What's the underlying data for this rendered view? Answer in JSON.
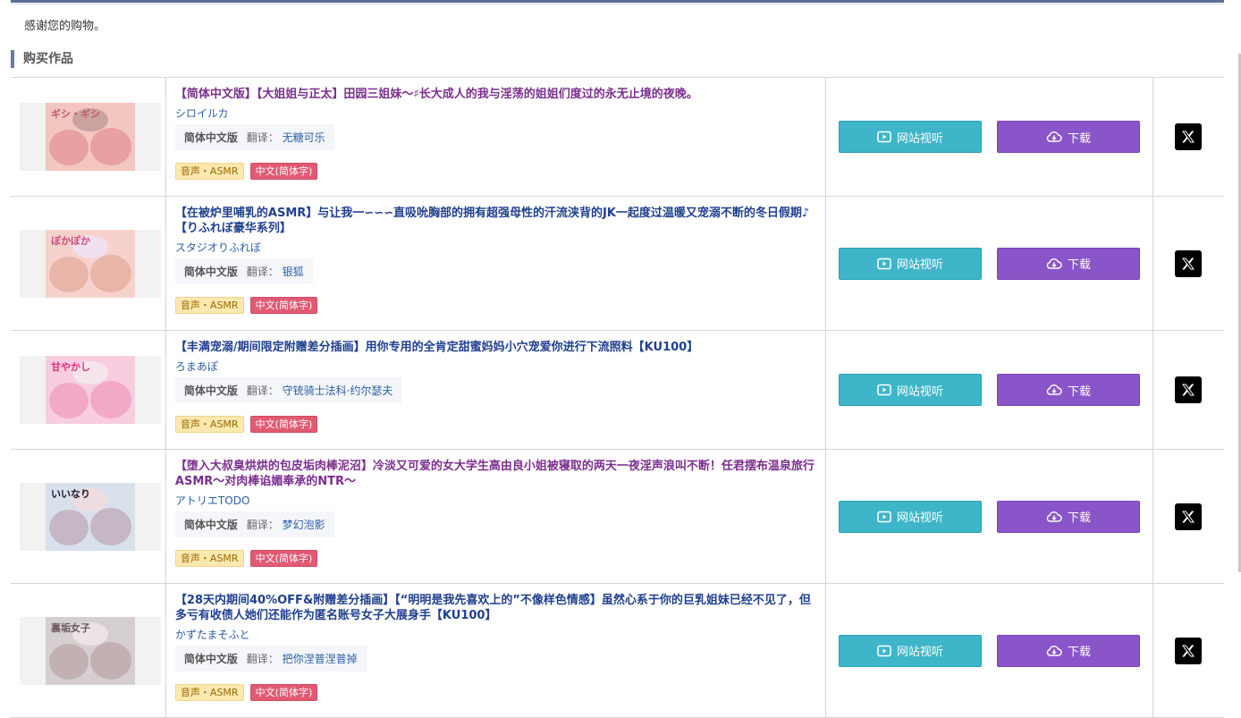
{
  "thanks": "感谢您的购物。",
  "section_title": "购买作品",
  "labels": {
    "lang_version": "简体中文版",
    "translator_prefix": "翻译：",
    "tag_voice": "音声・ASMR",
    "tag_lang": "中文(简体字)",
    "play_button": "网站视听",
    "download_button": "下载"
  },
  "items": [
    {
      "title": "【简体中文版】【大姐姐与正太】田园三姐妹～♯长大成人的我与淫荡的姐姐们度过的永无止境的夜晚。",
      "circle": "シロイルカ",
      "translator": "无糖可乐",
      "title_color": "#7b2f8e",
      "thumb_text": "ギシ・ギシ"
    },
    {
      "title": "【在被炉里哺乳的ASMR】与让我一∽∽∽直吸吮胸部的拥有超强母性的汗流浃背的JK一起度过温暖又宠溺不断的冬日假期♪【りふれぼ豪华系列】",
      "circle": "スタジオりふれぼ",
      "translator": "银狐",
      "title_color": "#1f3f8f",
      "thumb_text": "ぽかぽか"
    },
    {
      "title": "【丰满宠溺/期间限定附赠差分插画】用你专用的全肯定甜蜜妈妈小穴宠爱你进行下流照料【KU100】",
      "circle": "ろまあぽ",
      "translator": "守铳骑士法科·约尔瑟夫",
      "title_color": "#1f3f8f",
      "thumb_text": "甘やかし"
    },
    {
      "title": "【堕入大叔臭烘烘的包皮垢肉棒泥沼】冷淡又可爱的女大学生高由良小姐被寝取的两天一夜淫声浪叫不断！任君摆布温泉旅行ASMR～对肉棒谄媚奉承的NTR～",
      "circle": "アトリエTODO",
      "translator": "梦幻泡影",
      "title_color": "#7b2f8e",
      "thumb_text": "いいなり"
    },
    {
      "title": "【28天内期间40%OFF&附赠差分插画】【“明明是我先喜欢上的”不像样色情感】虽然心系于你的巨乳姐妹已经不见了，但多亏有收债人她们还能作为匿名账号女子大展身手【KU100】",
      "circle": "かずたまそふと",
      "translator": "把你涅普涅普掉",
      "title_color": "#1f3f8f",
      "thumb_text": "裏垢女子"
    }
  ]
}
